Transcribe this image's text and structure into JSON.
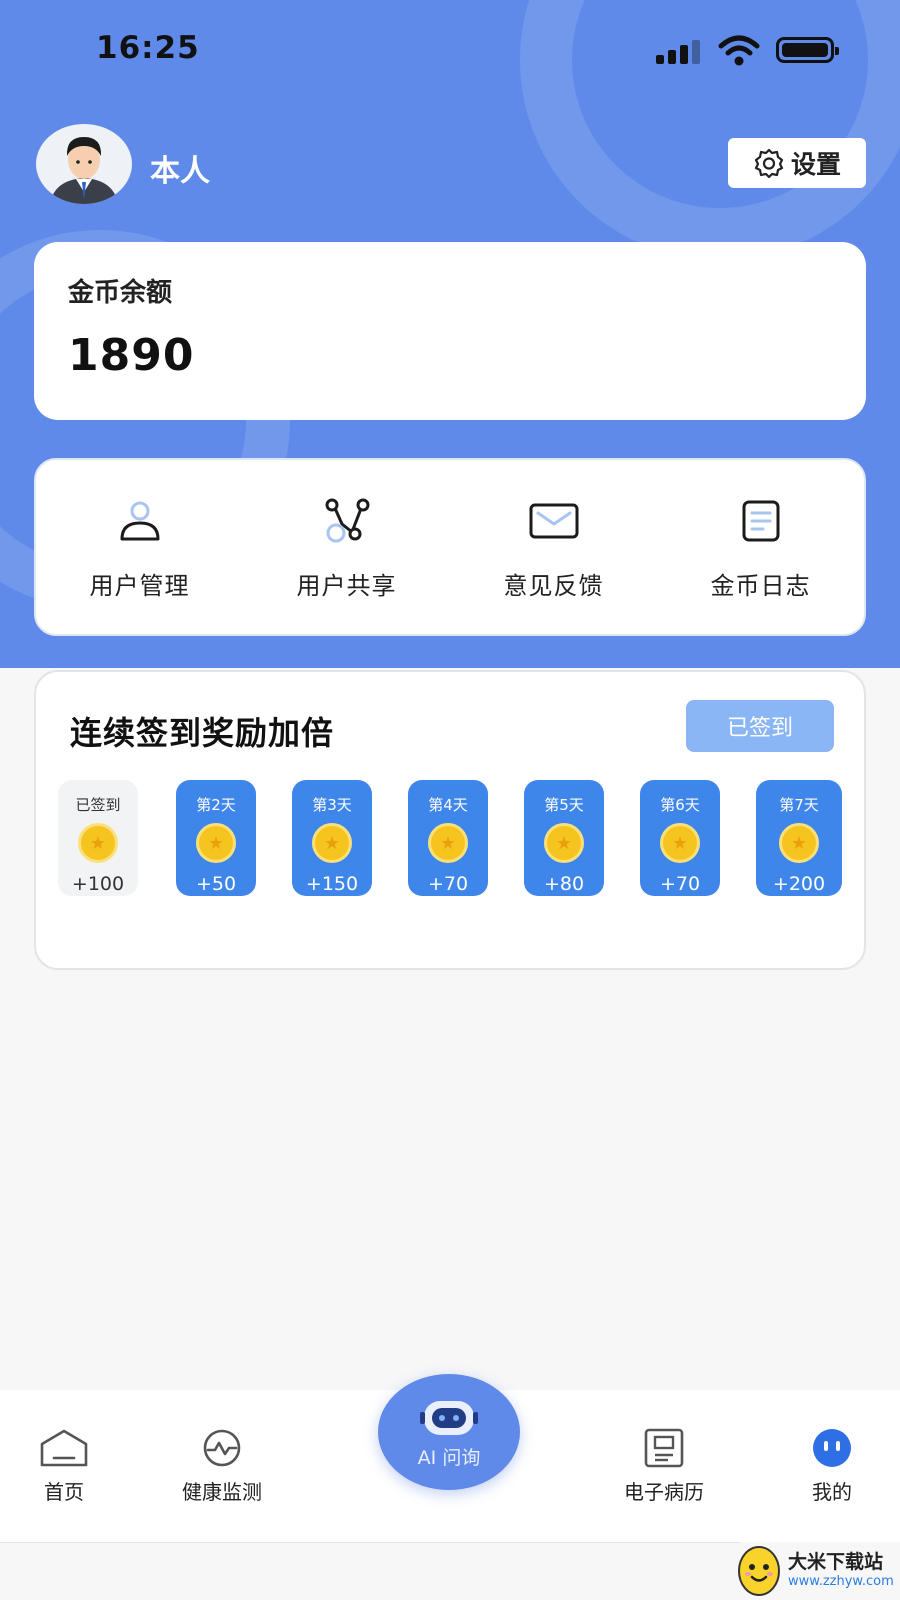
{
  "status_bar": {
    "time": "16:25"
  },
  "profile": {
    "name": "本人",
    "settings_label": "设置"
  },
  "balance": {
    "title": "金币余额",
    "value": "1890"
  },
  "menu": [
    {
      "label": "用户管理",
      "icon": "user-icon"
    },
    {
      "label": "用户共享",
      "icon": "share-icon"
    },
    {
      "label": "意见反馈",
      "icon": "mail-icon"
    },
    {
      "label": "金币日志",
      "icon": "document-icon"
    }
  ],
  "checkin": {
    "title": "连续签到奖励加倍",
    "button_label": "已签到",
    "days": [
      {
        "label": "已签到",
        "reward": "+100",
        "checked": true
      },
      {
        "label": "第2天",
        "reward": "+50",
        "checked": false
      },
      {
        "label": "第3天",
        "reward": "+150",
        "checked": false
      },
      {
        "label": "第4天",
        "reward": "+70",
        "checked": false
      },
      {
        "label": "第5天",
        "reward": "+80",
        "checked": false
      },
      {
        "label": "第6天",
        "reward": "+70",
        "checked": false
      },
      {
        "label": "第7天",
        "reward": "+200",
        "checked": false
      }
    ]
  },
  "tabbar": {
    "home": "首页",
    "health": "健康监测",
    "ai": "AI 问询",
    "records": "电子病历",
    "mine": "我的"
  },
  "watermark": {
    "name": "大米下载站",
    "url": "www.zzhyw.com"
  },
  "colors": {
    "brand": "#5f8aea",
    "day_card": "#3f86ea",
    "checked_button": "#8bb6f5",
    "coin": "#f6c41f"
  }
}
